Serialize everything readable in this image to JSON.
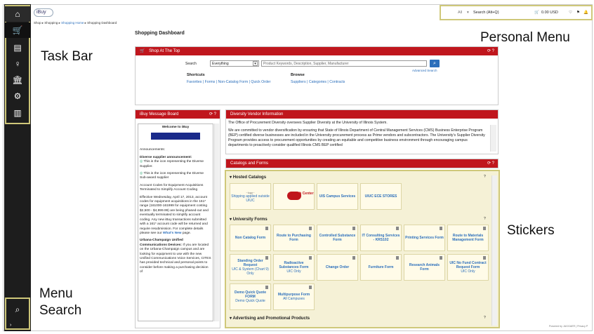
{
  "header": {
    "logo": "iBuy",
    "breadcrumb": [
      "Shop",
      "Shopping",
      "Shopping Home",
      "Shopping Dashboard"
    ],
    "search_scope": "All",
    "search_placeholder": "Search (Alt+Q)",
    "cart_total": "0.00 USD"
  },
  "annotations": {
    "task_bar": "Task Bar",
    "personal_menu": "Personal Menu",
    "stickers": "Stickers",
    "menu_search_1": "Menu",
    "menu_search_2": "Search"
  },
  "page_title": "Shopping Dashboard",
  "shop_at_top": {
    "title": "Shop At The Top",
    "search_label": "Search",
    "search_scope": "Everything",
    "search_placeholder": "Product Keywords, Description, Supplier, Manufacturer",
    "advanced_search": "Advanced Search",
    "shortcuts_label": "Shortcuts",
    "shortcuts": [
      "Favorites",
      "Forms",
      "Non-Catalog Form",
      "Quick Order"
    ],
    "browse_label": "Browse",
    "browse": [
      "Suppliers",
      "Categories",
      "Contracts"
    ]
  },
  "message_board": {
    "title": "iBuy Message Board",
    "welcome": "Welcome to iBuy",
    "announcements": "Announcements:",
    "diverse_heading": "Diverse supplier announcement:",
    "diverse_1": "This is the icon representing the Diverse Supplier.",
    "diverse_2": "This is the icon representing the Diverse Sub-award supplier",
    "account_codes": "Account Codes for Equipment Acquisitions Terminated to Simplify Account Coding",
    "effective": "Effective Wednesday, April 17, 2013, account codes for equipment acquisitions in the 161* range (161000-161999 for equipment costing $2,500 - $4,999.99) are being phased-out and eventually terminated to simplify account coding. Any new iBuy transactions submitted with a 161* account code will be returned and require resubmission. For complete details please see our",
    "whats_new": "What's New",
    "page": "page.",
    "urbana_heading": "Urbana-Champaign Unified Communications Devices:",
    "urbana_text": "If you are located on the Urbana-Champaign campus and are looking for equipment to use with the new Unified Communications Voice Services, CITES has provided technical and personal points to consider before making a purchasing decision of"
  },
  "diversity": {
    "title": "Diversity Vendor Information",
    "line1": "The Office of Procurement Diversity oversees Supplier Diversity at the University of Illinois System.",
    "para": "We are committed to vendor diversification by ensuring that State of Illinois Department of Central Management Services (CMS) Business Enterprise Program (BEP) certified diverse businesses are included in the University procurement process as Prime vendors and subcontractors. The University's Supplier Diversity Program provides access to procurement opportunities by creating an equitable and competitive business environment through encouraging campus departments to proactively consider qualified Illinois CMS BEP certified"
  },
  "catalogs": {
    "title": "Catalogs and Forms",
    "hosted_title": "Hosted Catalogs",
    "hosted": [
      {
        "name": "Shipping applied outside UIUC",
        "sub": ""
      },
      {
        "name": "Tech Center",
        "sub": ""
      },
      {
        "name": "UIS Campus Services",
        "sub": ""
      },
      {
        "name": "UIUC ECE STORES",
        "sub": ""
      }
    ],
    "forms_title": "University Forms",
    "forms": [
      {
        "name": "Non Catalog Form",
        "sub": ""
      },
      {
        "name": "Route to Purchasing Form",
        "sub": ""
      },
      {
        "name": "Controlled Substance Form",
        "sub": ""
      },
      {
        "name": "IT Consulting Services - KRS102",
        "sub": ""
      },
      {
        "name": "Printing Services Form",
        "sub": ""
      },
      {
        "name": "Route to Materials Management Form",
        "sub": ""
      },
      {
        "name": "Standing Order Request",
        "sub": "UIC & System (Chart 9) Only"
      },
      {
        "name": "Radioactive Substances Form",
        "sub": "UIC Only"
      },
      {
        "name": "Change Order",
        "sub": ""
      },
      {
        "name": "Furniture Form",
        "sub": ""
      },
      {
        "name": "Research Animals Form",
        "sub": ""
      },
      {
        "name": "UIC No Fund Contract Request Form",
        "sub": "UIC Only"
      },
      {
        "name": "Demo Quick Quote FORM",
        "sub": "Demo Quick Quote"
      },
      {
        "name": "Multipurpose Form",
        "sub": "All Campuses"
      }
    ],
    "advertising_title": "Advertising and Promotional Products"
  },
  "footer": "Powered by JAGGAER | Privacy P"
}
